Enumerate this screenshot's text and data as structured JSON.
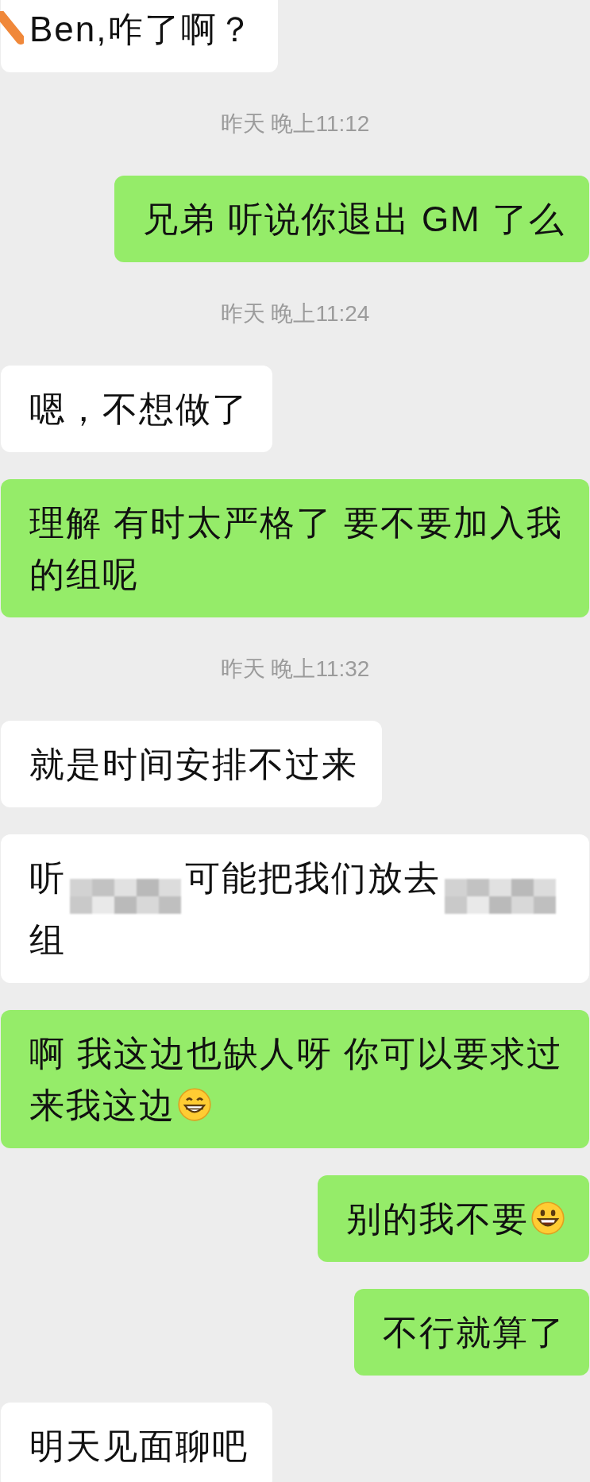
{
  "messages": [
    {
      "kind": "received",
      "segments": [
        {
          "kind": "text",
          "text": "Ben,咋了啊？"
        }
      ]
    },
    {
      "kind": "timestamp",
      "text": "昨天 晚上11:12"
    },
    {
      "kind": "sent",
      "segments": [
        {
          "kind": "text",
          "text": "兄弟 听说你退出 GM 了么"
        }
      ]
    },
    {
      "kind": "timestamp",
      "text": "昨天 晚上11:24"
    },
    {
      "kind": "received",
      "segments": [
        {
          "kind": "text",
          "text": "嗯，不想做了"
        }
      ]
    },
    {
      "kind": "sent",
      "segments": [
        {
          "kind": "text",
          "text": "理解 有时太严格了 要不要加入我的组呢"
        }
      ]
    },
    {
      "kind": "timestamp",
      "text": "昨天 晚上11:32"
    },
    {
      "kind": "received",
      "segments": [
        {
          "kind": "text",
          "text": "就是时间安排不过来"
        }
      ]
    },
    {
      "kind": "received",
      "segments": [
        {
          "kind": "text",
          "text": "听"
        },
        {
          "kind": "redacted"
        },
        {
          "kind": "text",
          "text": "可能把我们放去"
        },
        {
          "kind": "redacted"
        },
        {
          "kind": "text",
          "text": "组"
        }
      ]
    },
    {
      "kind": "sent",
      "segments": [
        {
          "kind": "text",
          "text": "啊 我这边也缺人呀 你可以要求过"
        },
        {
          "kind": "text",
          "text": "来我这边"
        },
        {
          "kind": "grin"
        }
      ]
    },
    {
      "kind": "sent",
      "segments": [
        {
          "kind": "text",
          "text": "别的我不要"
        },
        {
          "kind": "smile"
        }
      ]
    },
    {
      "kind": "sent",
      "segments": [
        {
          "kind": "text",
          "text": "不行就算了"
        }
      ]
    },
    {
      "kind": "received",
      "segments": [
        {
          "kind": "text",
          "text": "明天见面聊吧"
        }
      ]
    }
  ]
}
